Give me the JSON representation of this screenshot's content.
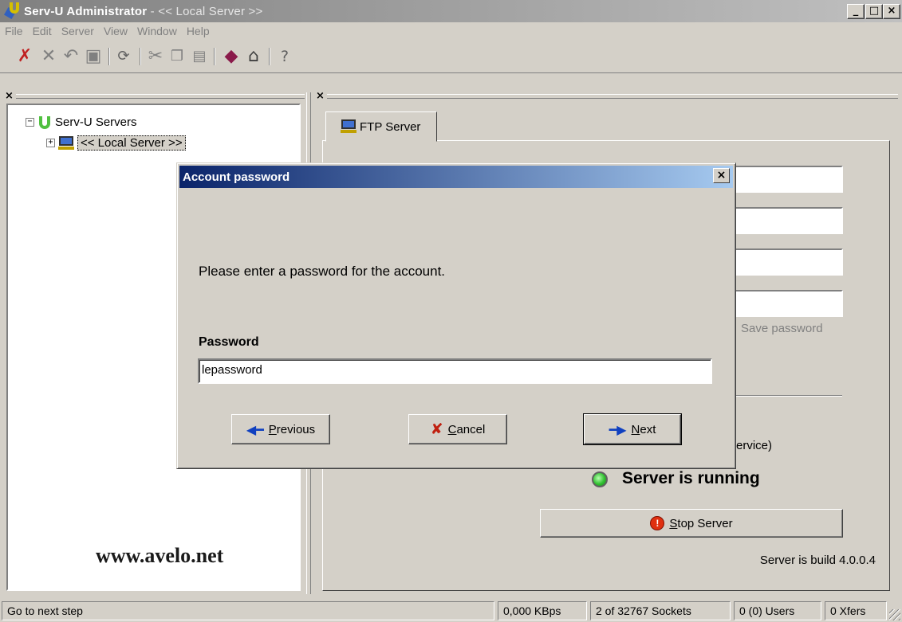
{
  "window": {
    "title_app": "Serv-U Administrator",
    "title_sep": " - ",
    "title_server": "<< Local Server >>",
    "minimize": "_",
    "maximize": "□",
    "close": "×"
  },
  "menu": [
    "File",
    "Edit",
    "Server",
    "View",
    "Window",
    "Help"
  ],
  "toolbar": {
    "icons": [
      "disconnect-icon",
      "delete-icon",
      "undo-icon",
      "save-icon",
      "refresh-icon",
      "cut-icon",
      "copy-icon",
      "paste-icon",
      "help-book-icon",
      "home-icon",
      "question-icon"
    ]
  },
  "pane_close": "×",
  "tree": {
    "root_expander": "−",
    "root_label": "Serv-U Servers",
    "child_expander": "+",
    "child_label": "<< Local Server >>"
  },
  "watermark": "www.avelo.net",
  "right": {
    "tab_label": "FTP Server",
    "save_password": "Save password",
    "service_text": "ervice)",
    "status_text": "Server is running",
    "stop_button": {
      "prefix": "",
      "accel": "S",
      "rest": "top Server"
    },
    "build": "Server is build 4.0.0.4"
  },
  "dialog": {
    "title": "Account password",
    "close": "×",
    "prompt": "Please enter a password for the account.",
    "password_label": "Password",
    "password_value": "lepassword",
    "buttons": {
      "previous": {
        "accel": "P",
        "rest": "revious"
      },
      "cancel": {
        "accel": "C",
        "rest": "ancel"
      },
      "next": {
        "accel": "N",
        "rest": "ext"
      }
    }
  },
  "statusbar": {
    "hint": "Go to next step",
    "speed": "0,000 KBps",
    "sockets": "2 of 32767 Sockets",
    "users": "0 (0) Users",
    "xfers": "0 Xfers"
  }
}
